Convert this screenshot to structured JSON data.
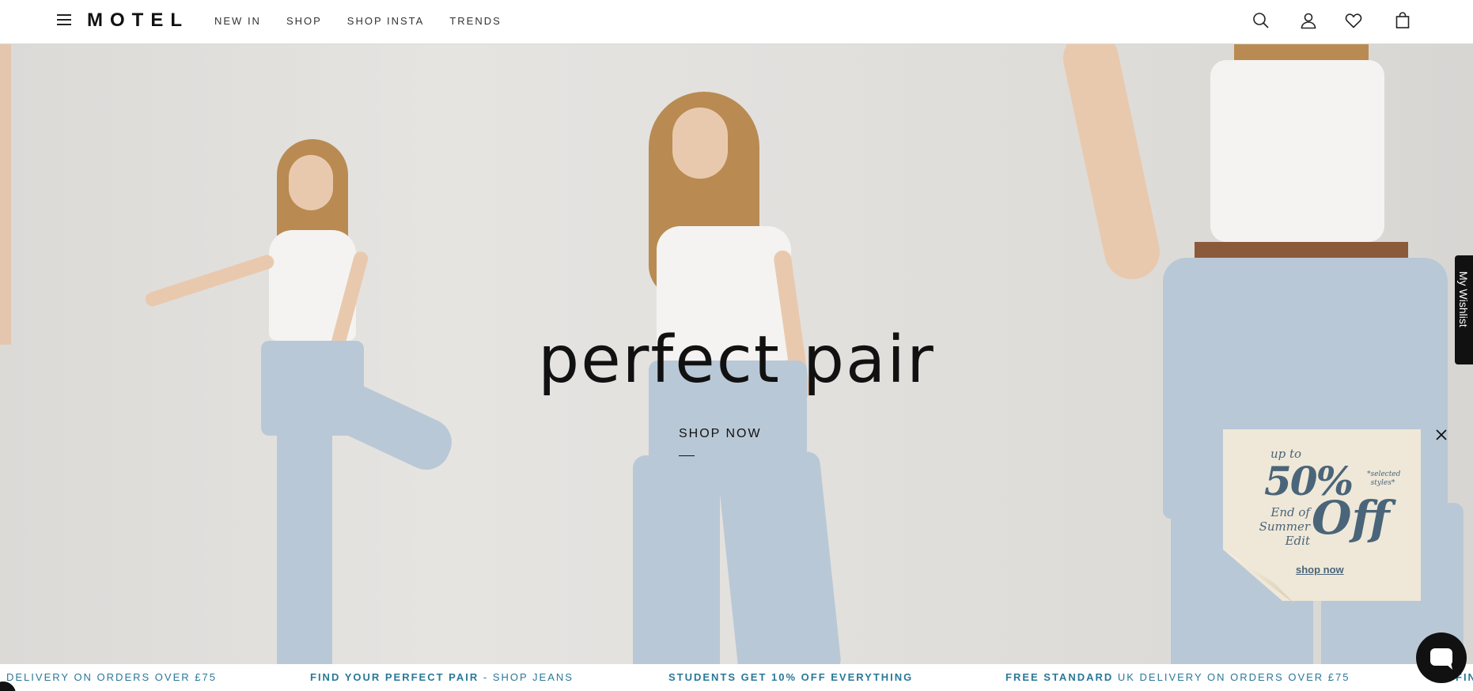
{
  "header": {
    "logo": "MOTEL",
    "nav": [
      "NEW IN",
      "SHOP",
      "SHOP INSTA",
      "TRENDS"
    ]
  },
  "hero": {
    "headline": "perfect pair",
    "cta": "SHOP NOW"
  },
  "wishlist_tab": {
    "label": "My Wishlist"
  },
  "promo": {
    "up_to": "up to",
    "percent": "50%",
    "note": "*selected styles*",
    "edit": [
      "End of",
      "Summer",
      "Edit"
    ],
    "off": "Off",
    "cta": "shop now"
  },
  "marquee": [
    {
      "bold": "",
      "text": "DELIVERY ON ORDERS OVER £75"
    },
    {
      "bold": "FIND YOUR PERFECT PAIR",
      "text": " - SHOP JEANS"
    },
    {
      "bold": "STUDENTS GET 10% OFF EVERYTHING",
      "text": ""
    },
    {
      "bold": "FREE STANDARD",
      "text": " UK DELIVERY ON ORDERS OVER £75"
    },
    {
      "bold": "FIND",
      "text": ""
    }
  ],
  "colors": {
    "accent": "#2a7898",
    "promo_text": "#4a6579",
    "promo_bg": "#efe8d8"
  },
  "icons": [
    "menu-icon",
    "search-icon",
    "account-icon",
    "heart-icon",
    "bag-icon",
    "close-icon",
    "chat-icon",
    "accessibility-icon"
  ]
}
